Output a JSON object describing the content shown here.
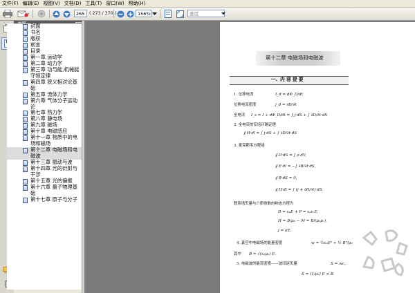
{
  "menu": [
    "文件(F)",
    "编辑(E)",
    "视图(V)",
    "文档(D)",
    "工具(T)",
    "窗口(W)",
    "帮助(H)"
  ],
  "toolbar": {
    "page_number": "265",
    "page_total": "( 273 / 370 )",
    "zoom": "156%",
    "search_placeholder": "查找"
  },
  "panel": {
    "title": "书签"
  },
  "bookmarks": [
    "封面",
    "书名",
    "版权",
    "前言",
    "目录",
    "第一章 运动学",
    "第二章 动力学",
    "第三章 功与能,机械能守恒定律",
    "第四章 狭义相对论基础",
    "第五章 流体力学",
    "第六章 气体分子运动论",
    "第七章 热力学",
    "第八章 静电场",
    "第九章 磁场",
    "第十章 电磁感应",
    "第十一章 物质中的电场和磁场",
    "第十二章 电磁场和电磁波",
    "第十三章 振动与波",
    "第十四章 光的衍射与干涉",
    "第十五章 光的偏振",
    "第十六章 量子物理基础",
    "第十七章 原子与分子"
  ],
  "selected_bookmark_index": 16,
  "doc": {
    "chapter_title": "第十二章   电磁场和电磁波",
    "section_title": "一、内 容 提 要",
    "items": [
      "1. 位移电流",
      "位移电流密度",
      "全电流",
      "2. 全电流的安培环路定理",
      "3. 麦克斯韦方程组",
      "联系场矢量与介质常数的物态方程为",
      "4. 真空中电磁场的能量密度",
      "其中",
      "5. 电磁波的能流密度——波印廷矢量"
    ],
    "equations": {
      "displacement_current": "I_d = dΦ_D/dt",
      "displacement_density": "j_d = ∂D/∂t",
      "total_current": "I_s = I + dΦ_D/dt = ∫ j·dS + ∫ ∂D/∂t·dS",
      "ampere_law": "∮ H·dl = ∫ j·dS + ∫ ∂D/∂t·dS",
      "maxwell_1": "∮ D·dS = ∫ ρ dV,",
      "maxwell_2": "∮ E·dl = −∫ ∂B/∂t·dS,",
      "maxwell_3": "∮ B·dS = 0,",
      "maxwell_4": "∮ H·dl = ∫ (j + ∂D/∂t)·dS.",
      "const_1": "D = ε₀E + P = ε₀εᵣE,",
      "const_2": "H = B/μ₀ − M = B/(μ₀μᵣ),",
      "const_3": "j = σE.",
      "energy": "w = ½ε₀E² + ½ B²/μ₀",
      "where": "B = √(ε₀μ₀) E.",
      "poynting_1": "S = wc,",
      "poynting_2": "S = (1/μ₀) E × B"
    }
  },
  "colors": {
    "panel_header": "#5a5a5a",
    "doc_background": "#7b7b7b",
    "bookmark_icon": "#315a9c",
    "chapter_band": "#cfcfcf"
  }
}
